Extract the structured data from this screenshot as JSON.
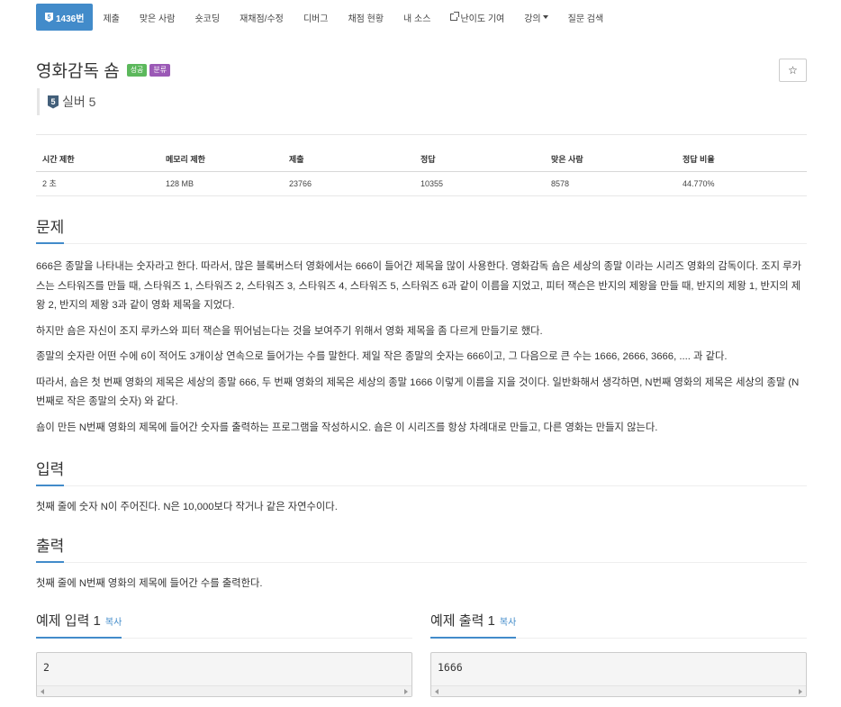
{
  "nav": {
    "items": [
      {
        "label": "1436번",
        "badge": "5",
        "active": true
      },
      {
        "label": "제출"
      },
      {
        "label": "맞은 사람"
      },
      {
        "label": "숏코딩"
      },
      {
        "label": "재채점/수정"
      },
      {
        "label": "디버그"
      },
      {
        "label": "채점 현황"
      },
      {
        "label": "내 소스"
      },
      {
        "label": "난이도 기여",
        "icon": "external-link-icon"
      },
      {
        "label": "강의",
        "icon": "caret-down-icon"
      },
      {
        "label": "질문 검색"
      }
    ]
  },
  "problem": {
    "title": "영화감독 숌",
    "tags": [
      "성공",
      "분류"
    ],
    "tag_colors": [
      "#5cb85c",
      "#9b59b6"
    ],
    "star_icon": "☆",
    "tier_number": "5",
    "tier_label": "실버 5",
    "tier_color": "#435f7a"
  },
  "stats": {
    "headers": [
      "시간 제한",
      "메모리 제한",
      "제출",
      "정답",
      "맞은 사람",
      "정답 비율"
    ],
    "values": [
      "2 초",
      "128 MB",
      "23766",
      "10355",
      "8578",
      "44.770%"
    ]
  },
  "sections": {
    "problem_title": "문제",
    "problem_paragraphs": [
      "666은 종말을 나타내는 숫자라고 한다. 따라서, 많은 블록버스터 영화에서는 666이 들어간 제목을 많이 사용한다. 영화감독 숌은 세상의 종말 이라는 시리즈 영화의 감독이다. 조지 루카스는 스타워즈를 만들 때, 스타워즈 1, 스타워즈 2, 스타워즈 3, 스타워즈 4, 스타워즈 5, 스타워즈 6과 같이 이름을 지었고, 피터 잭슨은 반지의 제왕을 만들 때, 반지의 제왕 1, 반지의 제왕 2, 반지의 제왕 3과 같이 영화 제목을 지었다.",
      "하지만 숌은 자신이 조지 루카스와 피터 잭슨을 뛰어넘는다는 것을 보여주기 위해서 영화 제목을 좀 다르게 만들기로 했다.",
      "종말의 숫자란 어떤 수에 6이 적어도 3개이상 연속으로 들어가는 수를 말한다. 제일 작은 종말의 숫자는 666이고, 그 다음으로 큰 수는 1666, 2666, 3666, .... 과 같다.",
      "따라서, 숌은 첫 번째 영화의 제목은 세상의 종말 666, 두 번째 영화의 제목은 세상의 종말 1666 이렇게 이름을 지을 것이다. 일반화해서 생각하면, N번째 영화의 제목은 세상의 종말 (N번째로 작은 종말의 숫자) 와 같다.",
      "숌이 만든 N번째 영화의 제목에 들어간 숫자를 출력하는 프로그램을 작성하시오. 숌은 이 시리즈를 항상 차례대로 만들고, 다른 영화는 만들지 않는다."
    ],
    "input_title": "입력",
    "input_text": "첫째 줄에 숫자 N이 주어진다. N은 10,000보다 작거나 같은 자연수이다.",
    "output_title": "출력",
    "output_text": "첫째 줄에 N번째 영화의 제목에 들어간 수를 출력한다."
  },
  "samples": {
    "input_title": "예제 입력 1",
    "output_title": "예제 출력 1",
    "copy_label": "복사",
    "input_value": "2",
    "output_value": "1666"
  }
}
